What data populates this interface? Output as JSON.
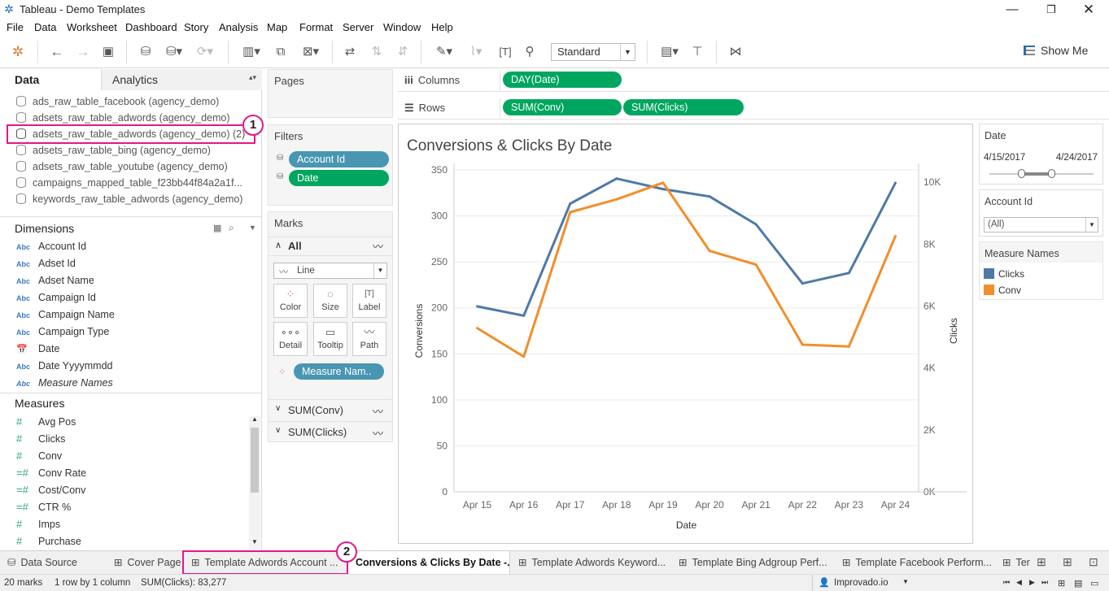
{
  "window": {
    "title": "Tableau - Demo Templates"
  },
  "menu": [
    "File",
    "Data",
    "Worksheet",
    "Dashboard",
    "Story",
    "Analysis",
    "Map",
    "Format",
    "Server",
    "Window",
    "Help"
  ],
  "toolbar": {
    "fit": "Standard",
    "show_me": "Show Me"
  },
  "left": {
    "tab_data": "Data",
    "tab_analytics": "Analytics",
    "datasources": [
      "ads_raw_table_facebook (agency_demo)",
      "adsets_raw_table_adwords (agency_demo)",
      "adsets_raw_table_adwords (agency_demo) (2)",
      "adsets_raw_table_bing (agency_demo)",
      "adsets_raw_table_youtube (agency_demo)",
      "campaigns_mapped_table_f23bb44f84a2a1f...",
      "keywords_raw_table_adwords (agency_demo)"
    ],
    "dimensions_title": "Dimensions",
    "dimensions": [
      {
        "type": "Abc",
        "name": "Account Id"
      },
      {
        "type": "Abc",
        "name": "Adset Id"
      },
      {
        "type": "Abc",
        "name": "Adset Name"
      },
      {
        "type": "Abc",
        "name": "Campaign Id"
      },
      {
        "type": "Abc",
        "name": "Campaign Name"
      },
      {
        "type": "Abc",
        "name": "Campaign Type"
      },
      {
        "type": "date",
        "name": "Date"
      },
      {
        "type": "Abc",
        "name": "Date Yyyymmdd"
      },
      {
        "type": "Abc",
        "name": "Measure Names"
      }
    ],
    "measures_title": "Measures",
    "measures": [
      {
        "type": "#",
        "name": "Avg Pos"
      },
      {
        "type": "#",
        "name": "Clicks"
      },
      {
        "type": "#",
        "name": "Conv"
      },
      {
        "type": "=#",
        "name": "Conv Rate"
      },
      {
        "type": "=#",
        "name": "Cost/Conv"
      },
      {
        "type": "=#",
        "name": "CTR %"
      },
      {
        "type": "#",
        "name": "Imps"
      },
      {
        "type": "#",
        "name": "Purchase"
      }
    ]
  },
  "callouts": [
    "1",
    "2"
  ],
  "shelves": {
    "pages": "Pages",
    "filters": "Filters",
    "filter_pills": [
      "Account Id",
      "Date"
    ],
    "marks": "Marks",
    "marks_all": "All",
    "mark_type": "Line",
    "mark_buttons": [
      "Color",
      "Size",
      "Label",
      "Detail",
      "Tooltip",
      "Path"
    ],
    "marks_pill": "Measure Nam..",
    "marks_cards": [
      "SUM(Conv)",
      "SUM(Clicks)"
    ],
    "columns_label": "Columns",
    "columns_pill": "DAY(Date)",
    "rows_label": "Rows",
    "rows_pills": [
      "SUM(Conv)",
      "SUM(Clicks)"
    ]
  },
  "side": {
    "date_title": "Date",
    "date_start": "4/15/2017",
    "date_end": "4/24/2017",
    "account_title": "Account Id",
    "account_value": "(All)",
    "legend_title": "Measure Names",
    "legend": [
      {
        "name": "Clicks",
        "color": "#4e79a7"
      },
      {
        "name": "Conv",
        "color": "#f28e2b"
      }
    ]
  },
  "bottom_tabs": [
    "Data Source",
    "Cover Page",
    "Template Adwords Account ...",
    "Conversions & Clicks By Date -...",
    "Template Adwords Keyword...",
    "Template Bing Adgroup Perf...",
    "Template Facebook Perform...",
    "Ter"
  ],
  "status": {
    "marks": "20 marks",
    "rows": "1 row by 1 column",
    "sum": "SUM(Clicks): 83,277",
    "user": "Improvado.io"
  },
  "chart_data": {
    "type": "line",
    "title": "Conversions & Clicks By Date",
    "xlabel": "Date",
    "ylabel": "Conversions",
    "y2label": "Clicks",
    "categories": [
      "Apr 15",
      "Apr 16",
      "Apr 17",
      "Apr 18",
      "Apr 19",
      "Apr 20",
      "Apr 21",
      "Apr 22",
      "Apr 23",
      "Apr 24"
    ],
    "ylim": [
      0,
      350
    ],
    "y_ticks": [
      "0",
      "50",
      "100",
      "150",
      "200",
      "250",
      "300",
      "350"
    ],
    "y2lim": [
      0,
      10400
    ],
    "y2_ticks": [
      "0K",
      "2K",
      "4K",
      "6K",
      "8K",
      "10K"
    ],
    "series": [
      {
        "name": "Clicks",
        "axis": "right",
        "color": "#4e79a7",
        "values": [
          5990,
          5690,
          9310,
          10120,
          9780,
          9540,
          8640,
          6730,
          7070,
          9980
        ]
      },
      {
        "name": "Conv",
        "axis": "left",
        "color": "#f28e2b",
        "values": [
          178,
          147,
          304,
          318,
          336,
          262,
          247,
          160,
          158,
          278
        ]
      }
    ]
  }
}
